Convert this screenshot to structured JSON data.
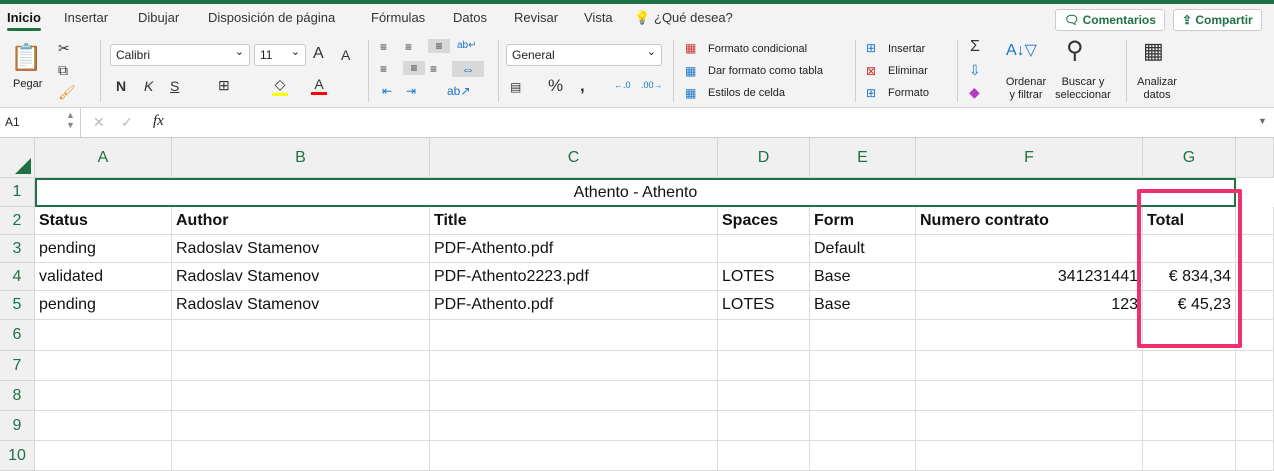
{
  "tabs": [
    "Inicio",
    "Insertar",
    "Dibujar",
    "Disposición de página",
    "Fórmulas",
    "Datos",
    "Revisar",
    "Vista"
  ],
  "tell_me": "¿Qué desea?",
  "comments_button": "Comentarios",
  "share_button": "Compartir",
  "ribbon": {
    "paste": "Pegar",
    "font_name": "Calibri",
    "font_size": "11",
    "bold": "N",
    "italic": "K",
    "underline": "S",
    "number_format": "General",
    "conditional_format": "Formato condicional",
    "format_as_table": "Dar formato como tabla",
    "cell_styles": "Estilos de celda",
    "insert": "Insertar",
    "delete": "Eliminar",
    "format": "Formato",
    "sort_filter": "Ordenar y filtrar",
    "find_select": "Buscar y seleccionar",
    "analyze": "Analizar datos",
    "fill_color": "#ffff00",
    "font_color": "#ff0000"
  },
  "formula_bar": {
    "name_box": "A1",
    "fx": "fx",
    "value": ""
  },
  "columns": [
    "A",
    "B",
    "C",
    "D",
    "E",
    "F",
    "G"
  ],
  "rows": [
    "1",
    "2",
    "3",
    "4",
    "5",
    "6",
    "7",
    "8",
    "9",
    "10"
  ],
  "title_row": "Athento   - Athento",
  "headers": [
    "Status",
    "Author",
    "Title",
    "Spaces",
    "Form",
    "Numero contrato",
    "Total"
  ],
  "data": [
    [
      "pending",
      "Radoslav Stamenov",
      "PDF-Athento.pdf",
      "",
      "Default",
      "",
      ""
    ],
    [
      "validated",
      "Radoslav Stamenov",
      "PDF-Athento2223.pdf",
      "LOTES",
      "Base",
      "341231441",
      "€ 834,34"
    ],
    [
      "pending",
      "Radoslav Stamenov",
      "PDF-Athento.pdf",
      "LOTES",
      "Base",
      "123",
      "€ 45,23"
    ]
  ],
  "highlight_color": "#f0306c"
}
